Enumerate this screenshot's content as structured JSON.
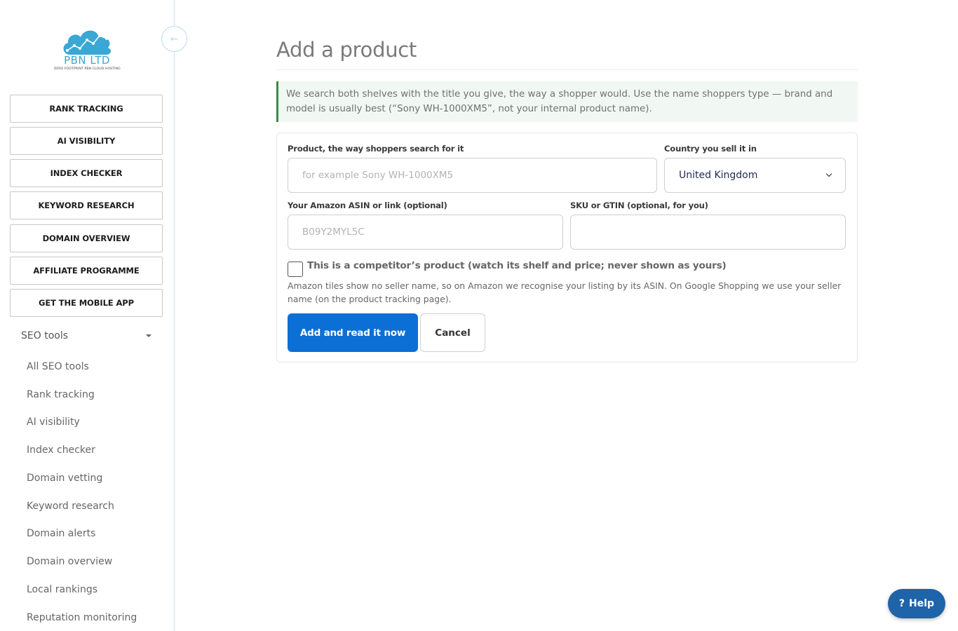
{
  "brand": {
    "name": "PBN LTD",
    "tagline": "ZERO FOOTPRINT PBN CLOUD HOSTING",
    "accent": "#3aa7d4"
  },
  "sidebar": {
    "collapse_icon": "arrow-left-icon",
    "nav_buttons": [
      "RANK TRACKING",
      "AI VISIBILITY",
      "INDEX CHECKER",
      "KEYWORD RESEARCH",
      "DOMAIN OVERVIEW",
      "AFFILIATE PROGRAMME",
      "GET THE MOBILE APP"
    ],
    "seo_tools_label": "SEO tools",
    "seo_tools_items": [
      "All SEO tools",
      "Rank tracking",
      "AI visibility",
      "Index checker",
      "Domain vetting",
      "Keyword research",
      "Domain alerts",
      "Domain overview",
      "Local rankings",
      "Reputation monitoring"
    ]
  },
  "main": {
    "title": "Add a product",
    "notice": "We search both shelves with the title you give, the way a shopper would. Use the name shoppers type — brand and model is usually best (“Sony WH-1000XM5”, not your internal product name).",
    "form": {
      "product_label": "Product, the way shoppers search for it",
      "product_placeholder": "for example Sony WH-1000XM5",
      "country_label": "Country you sell it in",
      "country_value": "United Kingdom",
      "asin_label": "Your Amazon ASIN or link (optional)",
      "asin_placeholder": "B09Y2MYL5C",
      "sku_label": "SKU or GTIN (optional, for you)",
      "sku_placeholder": "",
      "competitor_label": "This is a competitor’s product (watch its shelf and price; never shown as yours)",
      "help_text": "Amazon tiles show no seller name, so on Amazon we recognise your listing by its ASIN. On Google Shopping we use your seller name (on the product tracking page).",
      "submit_label": "Add and read it now",
      "cancel_label": "Cancel"
    }
  },
  "help_button": {
    "icon": "?",
    "label": "Help"
  },
  "colors": {
    "primary": "#0b6fd6",
    "notice_border": "#3a8a4a",
    "notice_bg": "#f1f8f3",
    "help_bg": "#1f63a8"
  }
}
